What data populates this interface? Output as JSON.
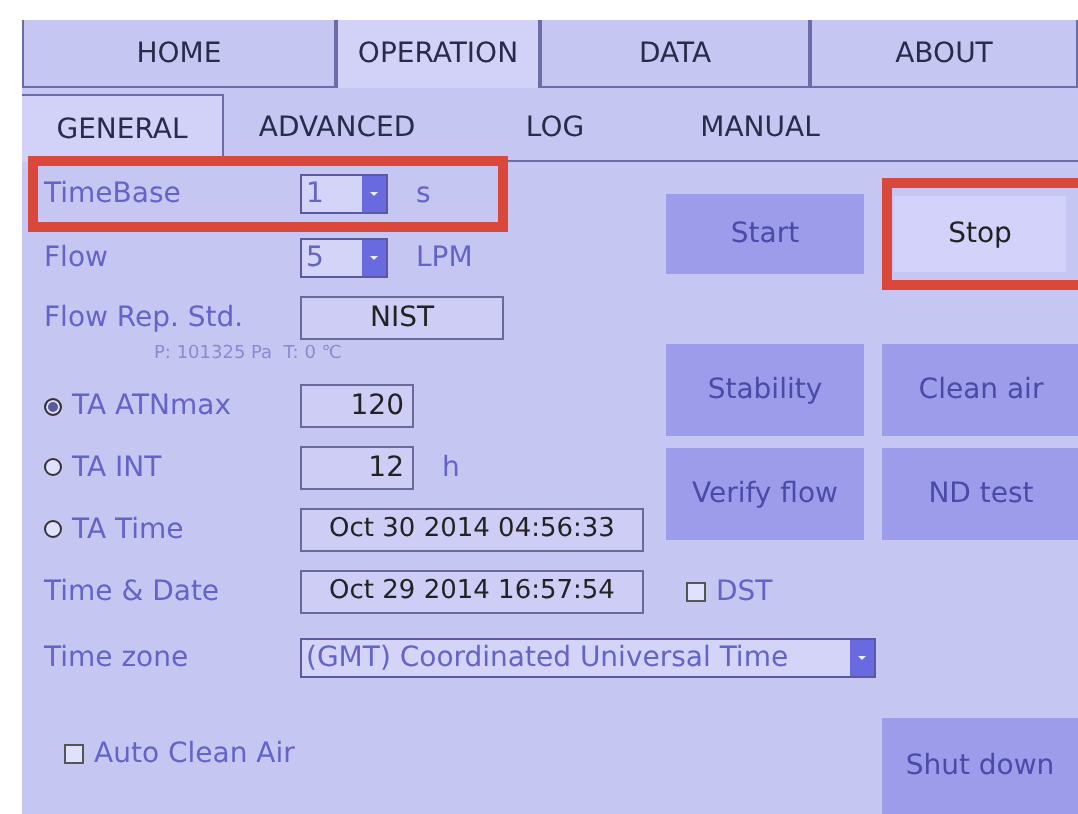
{
  "tabs": [
    {
      "label": "HOME",
      "selected": false
    },
    {
      "label": "OPERATION",
      "selected": true
    },
    {
      "label": "DATA",
      "selected": false
    },
    {
      "label": "ABOUT",
      "selected": false
    }
  ],
  "subtabs": [
    {
      "label": "GENERAL",
      "selected": true
    },
    {
      "label": "ADVANCED",
      "selected": false
    },
    {
      "label": "LOG",
      "selected": false
    },
    {
      "label": "MANUAL",
      "selected": false
    }
  ],
  "settings": [
    {
      "kind": "select",
      "label": "TimeBase",
      "value": "1",
      "unit": "s",
      "highlighted": true
    },
    {
      "kind": "select",
      "label": "Flow",
      "value": "5",
      "unit": "LPM",
      "highlighted": false
    },
    {
      "kind": "field",
      "label": "Flow Rep. Std.",
      "value": "NIST",
      "note": "P: 101325 Pa  T: 0 ℃"
    },
    {
      "kind": "radio",
      "label": "TA ATNmax",
      "value": "120",
      "selected": true
    },
    {
      "kind": "radio",
      "label": "TA INT",
      "value": "12",
      "unit": "h",
      "selected": false
    },
    {
      "kind": "radio",
      "label": "TA Time",
      "value": "Oct 30 2014 04:56:33",
      "selected": false
    },
    {
      "kind": "field",
      "label": "Time & Date",
      "value": "Oct 29 2014 16:57:54"
    },
    {
      "kind": "wide-select",
      "label": "Time zone",
      "value": "(GMT) Coordinated Universal Time"
    }
  ],
  "dst": {
    "label": "DST",
    "checked": false
  },
  "auto_clean_air": {
    "label": "Auto Clean Air",
    "checked": false
  },
  "buttons": [
    {
      "label": "Start",
      "disabled": true,
      "highlighted": false
    },
    {
      "label": "Stop",
      "disabled": false,
      "highlighted": true
    },
    {
      "label": "Stability",
      "disabled": true,
      "highlighted": false
    },
    {
      "label": "Clean air",
      "disabled": true,
      "highlighted": false
    },
    {
      "label": "Verify flow",
      "disabled": true,
      "highlighted": false
    },
    {
      "label": "ND test",
      "disabled": true,
      "highlighted": false
    },
    {
      "label": "Shut down",
      "disabled": true,
      "highlighted": false
    }
  ]
}
